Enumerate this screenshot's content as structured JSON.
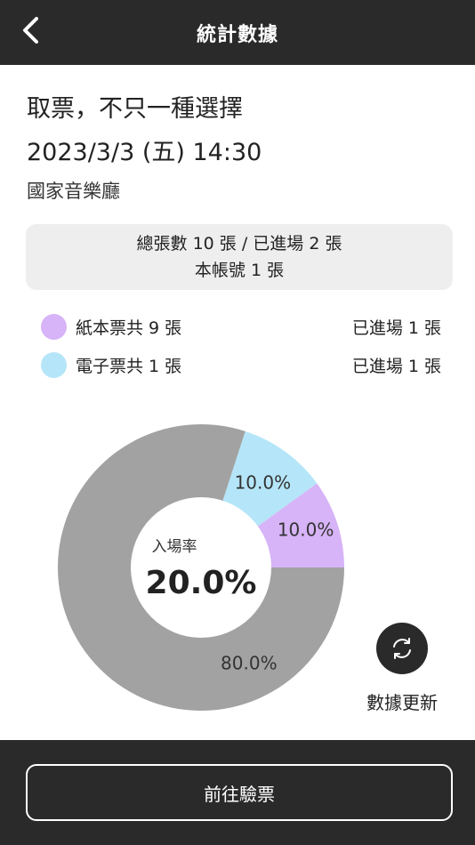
{
  "header": {
    "title": "統計數據",
    "back_icon": "chevron-left-icon"
  },
  "event": {
    "name": "取票，不只一種選擇",
    "datetime": "2023/3/3 (五) 14:30",
    "venue": "國家音樂廳"
  },
  "summary": {
    "line1": "總張數 10 張 / 已進場 2 張",
    "line2": "本帳號 1 張"
  },
  "legend": [
    {
      "label": "紙本票共 9 張",
      "entered": "已進場 1 張",
      "color": "#d7b3f7"
    },
    {
      "label": "電子票共 1 張",
      "entered": "已進場 1 張",
      "color": "#b5e5f8"
    }
  ],
  "chart_data": {
    "type": "pie",
    "donut": true,
    "slices": [
      {
        "value": 10.0,
        "label": "10.0%",
        "color": "#d7b3f7"
      },
      {
        "value": 10.0,
        "label": "10.0%",
        "color": "#b5e5f8"
      },
      {
        "value": 80.0,
        "label": "80.0%",
        "color": "#a2a2a2"
      }
    ],
    "center_caption": "入場率",
    "center_value": "20.0%"
  },
  "refresh": {
    "label": "數據更新",
    "icon": "refresh-icon"
  },
  "footer": {
    "button_label": "前往驗票"
  },
  "colors": {
    "bar_background": "#2a2a2a",
    "summary_background": "#eeeeee"
  }
}
